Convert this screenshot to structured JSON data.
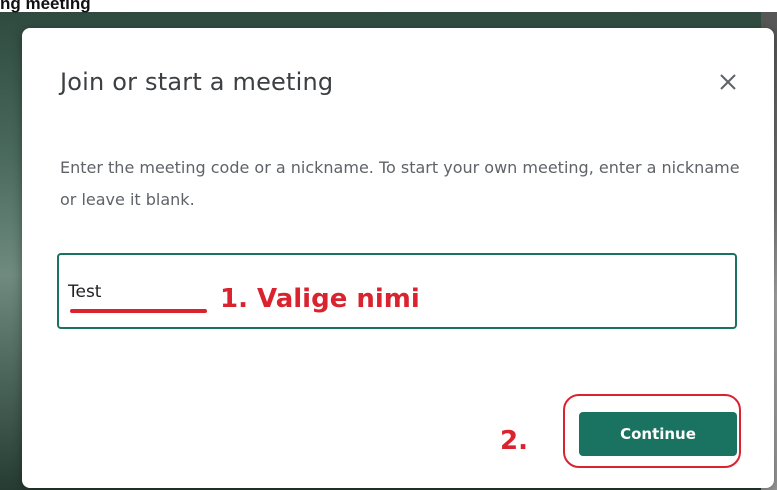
{
  "page_top_text": "ng meeting",
  "dialog": {
    "title": "Join or start a meeting",
    "close_icon": "close-icon",
    "description": "Enter the meeting code or a nickname. To start your own meeting, enter a nickname or leave it blank.",
    "input_value": "Test",
    "continue_label": "Continue"
  },
  "annotations": {
    "step1": "1. Valige nimi",
    "step2": "2."
  },
  "colors": {
    "accent": "#1a7360",
    "annotation_red": "#d9232e",
    "title_text": "#3c4043",
    "body_text": "#5f6368"
  }
}
